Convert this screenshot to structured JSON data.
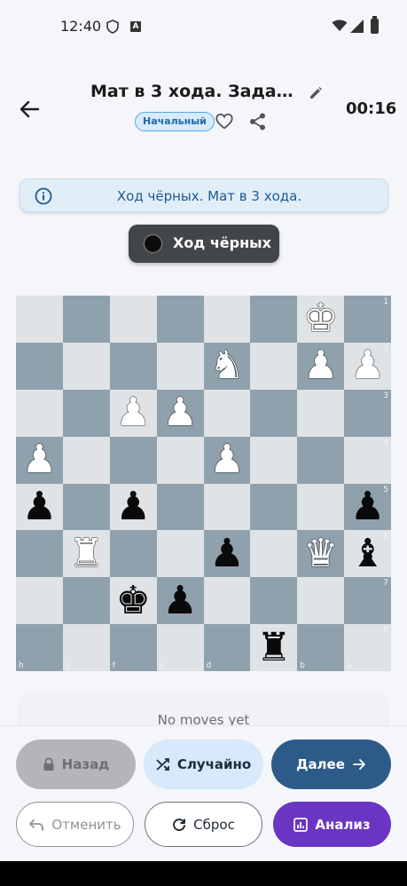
{
  "status_bar": {
    "time": "12:40",
    "a_badge": "A"
  },
  "header": {
    "title": "Мат в 3 хода. Задача ...",
    "badge": "Начальный",
    "timer": "00:16"
  },
  "info": {
    "text": "Ход чёрных. Мат в 3 хода."
  },
  "turn": {
    "label": "Ход чёрных"
  },
  "board": {
    "rows": [
      [
        "",
        "",
        "",
        "",
        "",
        "",
        "wk",
        ""
      ],
      [
        "",
        "",
        "",
        "",
        "wn",
        "",
        "wp",
        "wp"
      ],
      [
        "",
        "",
        "wp",
        "wp",
        "",
        "",
        "",
        ""
      ],
      [
        "wp",
        "",
        "",
        "",
        "wp",
        "",
        "",
        ""
      ],
      [
        "bp",
        "",
        "bp",
        "",
        "",
        "",
        "",
        "bp"
      ],
      [
        "",
        "wr",
        "",
        "",
        "bp",
        "",
        "wq",
        "bb"
      ],
      [
        "",
        "",
        "bk",
        "bp",
        "",
        "",
        "",
        ""
      ],
      [
        "",
        "",
        "",
        "",
        "",
        "br",
        "",
        ""
      ]
    ],
    "rank_labels": [
      "1",
      "2",
      "3",
      "4",
      "5",
      "6",
      "7",
      "8"
    ],
    "file_labels": [
      "h",
      "g",
      "f",
      "e",
      "d",
      "c",
      "b",
      "a"
    ],
    "colors": {
      "light": "#dfe3e6",
      "dark": "#8fa1ad"
    }
  },
  "moves": {
    "empty_text": "No moves yet"
  },
  "buttons": {
    "back": "Назад",
    "random": "Случайно",
    "next": "Далее",
    "undo": "Отменить",
    "reset": "Сброс",
    "analysis": "Анализ"
  },
  "colors": {
    "accent_blue": "#2d5b89",
    "accent_purple": "#6935c2"
  }
}
